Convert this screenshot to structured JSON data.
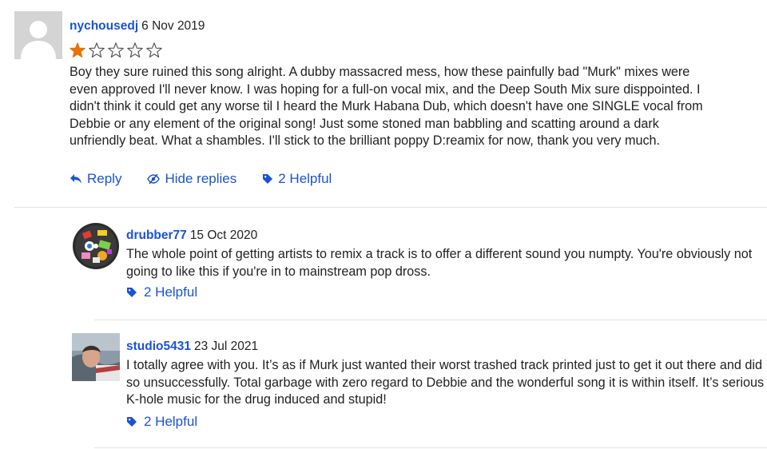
{
  "review": {
    "username": "nychousedj",
    "date": "6 Nov 2019",
    "rating": 1,
    "rating_max": 5,
    "text": "Boy they sure ruined this song alright. A dubby massacred mess, how these painfully bad \"Murk\" mixes were even approved I'll never know. I was hoping for a full-on vocal mix, and the Deep South Mix sure disppointed. I didn't think it could get any worse til I heard the Murk Habana Dub, which doesn't have one SINGLE vocal from Debbie or any element of the original song! Just some stoned man babbling and scatting around a dark unfriendly beat. What a shambles. I'll stick to the brilliant poppy D:reamix for now, thank you very much.",
    "reply_label": "Reply",
    "hide_replies_label": "Hide replies",
    "helpful_label": "2 Helpful"
  },
  "replies": [
    {
      "username": "drubber77",
      "date": "15 Oct 2020",
      "text": "The whole point of getting artists to remix a track is to offer a different sound you numpty. You're obviously not going to like this if you're in to mainstream pop dross.",
      "helpful_label": "2 Helpful"
    },
    {
      "username": "studio5431",
      "date": "23 Jul 2021",
      "text": "I totally agree with you. It’s as if Murk just wanted their worst trashed track printed just to get it out there and did so unsuccessfully. Total garbage with zero regard to Debbie and the wonderful song it is within itself. It’s serious K-hole music for the drug induced and stupid!",
      "helpful_label": "2 Helpful"
    }
  ],
  "colors": {
    "link": "#1a52d6",
    "star_filled": "#e8720c",
    "star_empty": "#555555"
  }
}
